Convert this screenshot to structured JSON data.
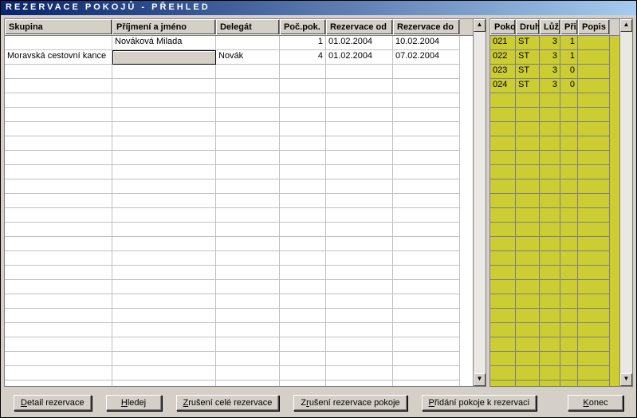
{
  "title": "REZERVACE POKOJŮ - PŘEHLED",
  "left": {
    "headers": [
      "Skupina",
      "Příjmení a jméno",
      "Delegát",
      "Poč.pok.",
      "Rezervace od",
      "Rezervace do"
    ],
    "rows": [
      {
        "skupina": "",
        "jmeno": "Nováková Milada",
        "delegat": "",
        "pocet": "1",
        "od": "01.02.2004",
        "do": "10.02.2004"
      },
      {
        "skupina": "Moravská cestovní kance",
        "jmeno": "",
        "delegat": "Novák",
        "pocet": "4",
        "od": "01.02.2004",
        "do": "07.02.2004"
      }
    ],
    "blank_rows": 23,
    "selected": {
      "row": 1,
      "col": 1
    }
  },
  "right": {
    "headers": [
      "Pokoj",
      "Druh",
      "Lůž.",
      "Při.",
      "Popis"
    ],
    "rows": [
      {
        "pokoj": "021",
        "druh": "ST",
        "luz": "3",
        "pri": "1",
        "popis": ""
      },
      {
        "pokoj": "022",
        "druh": "ST",
        "luz": "3",
        "pri": "1",
        "popis": ""
      },
      {
        "pokoj": "023",
        "druh": "ST",
        "luz": "3",
        "pri": "0",
        "popis": ""
      },
      {
        "pokoj": "024",
        "druh": "ST",
        "luz": "3",
        "pri": "0",
        "popis": ""
      }
    ],
    "blank_rows": 21
  },
  "buttons": {
    "detail": "Detail rezervace",
    "hledej": "Hledej",
    "zrus_cele": "Zrušení celé rezervace",
    "zrus_pokoj": "Zrušení rezervace pokoje",
    "pridani": "Přidání pokoje k rezervaci",
    "konec": "Konec"
  }
}
